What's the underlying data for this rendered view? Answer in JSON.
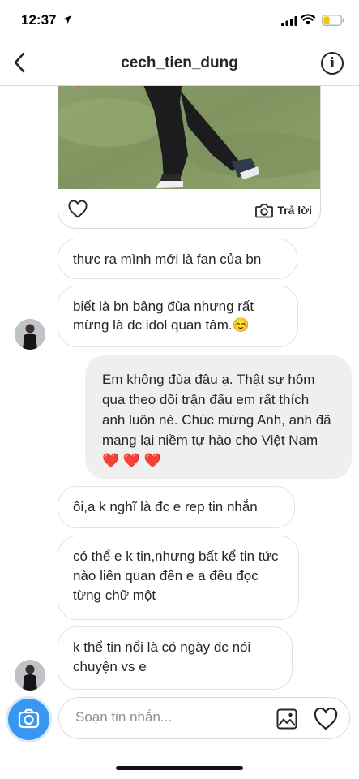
{
  "status_bar": {
    "time": "12:37",
    "icons": [
      "location-arrow-icon",
      "signal-bars-icon",
      "wifi-icon",
      "battery-icon"
    ],
    "battery_level": 0.35,
    "battery_color": "#f5c400"
  },
  "header": {
    "title": "cech_tien_dung",
    "back_icon": "chevron-left-icon",
    "info_icon": "info-icon",
    "info_glyph": "i"
  },
  "media_message": {
    "photo": "video-thumbnail",
    "like_icon": "heart-outline-icon",
    "reply_icon": "camera-icon",
    "reply_label": "Trả lời"
  },
  "messages": [
    {
      "sender": "them",
      "text": "thực ra mình mới là fan của bn"
    },
    {
      "sender": "them",
      "text": "biết là bn bâng đùa nhưng rất mừng là đc idol quan tâm.☺️"
    },
    {
      "sender": "me",
      "text": "Em không đùa đâu ạ. Thật sự hôm qua theo dõi trận đấu em rất thích anh luôn nè. Chúc mừng Anh, anh đã mang lại niềm tự hào cho Việt Nam ❤️ ❤️ ❤️"
    },
    {
      "sender": "them",
      "text": "ôi,a k nghĩ là đc e rep tin nhắn"
    },
    {
      "sender": "them",
      "text": "có thể e k tin,nhưng bất kể tin tức nào liên quan đến e a đều đọc từng chữ một"
    },
    {
      "sender": "them",
      "text": "k thể tin nổi là có ngày đc nói chuyện vs e"
    }
  ],
  "composer": {
    "placeholder": "Soạn tin nhắn...",
    "camera_icon": "camera-icon",
    "gallery_icon": "image-icon",
    "like_icon": "heart-outline-icon"
  },
  "colors": {
    "accent": "#3897f0",
    "my_bubble": "#efefef",
    "border": "#dbdbdb",
    "text": "#262626",
    "placeholder": "#8e8e8e"
  }
}
